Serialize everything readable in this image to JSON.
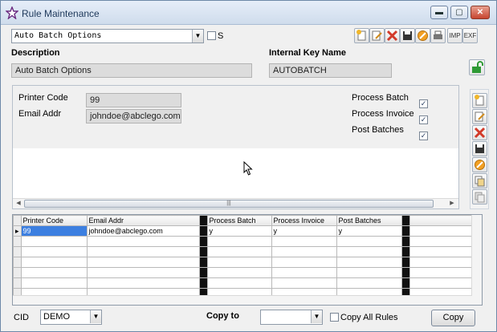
{
  "window": {
    "title": "Rule Maintenance",
    "minimize_glyph": "▬",
    "restore_glyph": "▢",
    "close_glyph": "✕"
  },
  "rule_select": {
    "value": "Auto Batch Options",
    "s_label": "S"
  },
  "toolbar": {
    "imp_label": "IMP",
    "exf_label": "EXF",
    "icons": [
      "new-icon",
      "edit-icon",
      "delete-icon",
      "save-icon",
      "cancel-icon",
      "print-icon"
    ]
  },
  "description": {
    "label": "Description",
    "value": "Auto Batch Options"
  },
  "internal_key": {
    "label": "Internal Key Name",
    "value": "AUTOBATCH"
  },
  "detail": {
    "printer_code_label": "Printer Code",
    "printer_code": "99",
    "email_label": "Email Addr",
    "email": "johndoe@abclego.com",
    "process_batch_label": "Process Batch",
    "process_batch": true,
    "process_invoice_label": "Process Invoice",
    "process_invoice": true,
    "post_batches_label": "Post Batches",
    "post_batches": true
  },
  "grid": {
    "columns": [
      "Printer Code",
      "Email Addr",
      "Process Batch",
      "Process Invoice",
      "Post Batches"
    ],
    "rows": [
      [
        "99",
        "johndoe@abclego.com",
        "y",
        "y",
        "y"
      ]
    ],
    "scroll_grip": "|||"
  },
  "footer": {
    "cid_label": "CID",
    "cid_value": "DEMO",
    "copy_to_label": "Copy to",
    "copy_to_value": "",
    "copy_all_label": "Copy All Rules",
    "copy_button": "Copy"
  },
  "colors": {
    "accent": "#3c7fe0",
    "close": "#c7452f",
    "delete": "#d23a2a",
    "lock": "#2f9a35"
  }
}
